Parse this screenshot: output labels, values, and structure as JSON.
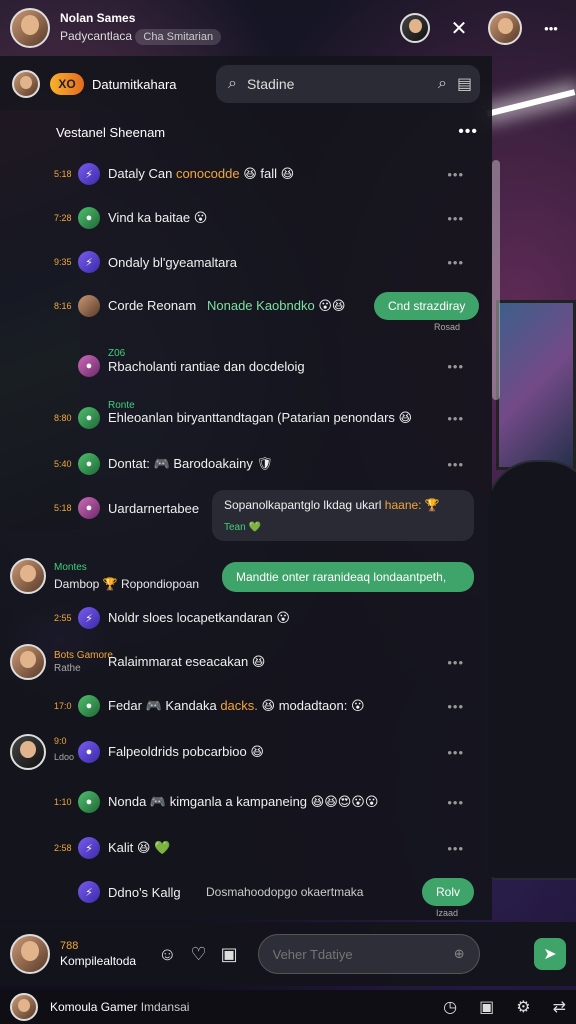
{
  "topbar": {
    "name": "Nolan Sames",
    "subtitle": "Padycantlaca",
    "pill": "Cha Smitarian",
    "close": "✕",
    "more": "•••"
  },
  "panel": {
    "brand_badge": "XO",
    "brand_name": "Datumitkahara",
    "search_value": "Stadine",
    "room_title": "Vestanel Sheenam",
    "more": "•••"
  },
  "messages": [
    {
      "time": "5:18",
      "text": "Dataly Can",
      "accent": "conocodde",
      "tail": "😆 fall 😆",
      "av": "v"
    },
    {
      "time": "7:28",
      "text": "Vind ka baitae 😮",
      "av": "g"
    },
    {
      "time": "9:35",
      "text": "Ondaly bl'gyeamaltara",
      "av": "v"
    },
    {
      "time": "8:16",
      "text": "Corde Reonam",
      "green": "Nonade Kaobndko",
      "tail": "😮😆",
      "bubble": "Cnd strazdiray",
      "meta": "Rosad",
      "av": "f"
    },
    {
      "tag": "Z06",
      "text": "Rbacholanti rantiae dan docdeloig",
      "av": "p"
    },
    {
      "tag": "Ronte",
      "text": "Ehleoanlan biryanttandtagan (Patarian penondars 😆",
      "av": "g",
      "time": "8:80"
    },
    {
      "time": "5:40",
      "text": "Dontat: 🎮 Barodoakainy 🛡",
      "av": "g"
    },
    {
      "time": "5:18",
      "text": "Uardarnertabee",
      "card": "Sopanolkapantglo lkdag ukarl",
      "card_acc": "haane:",
      "card_sub": "Tean",
      "av": "p"
    },
    {
      "tag": "Montes",
      "text": "Dambop 🏆 Ropondiopoan",
      "bubble": "Mandtie onter raranideaq londaantpeth,"
    },
    {
      "time": "2:55",
      "text": "Noldr sloes locapetkandaran 😮",
      "av": "v"
    },
    {
      "tag": "Bots Gamore",
      "sub": "Rathe",
      "text": "Ralaimmarat eseacakan 😆"
    },
    {
      "time": "17:0",
      "text": "Fedar 🎮 Kandaka",
      "accent": "dacks.",
      "tail": "😆 modadtaon: 😮",
      "av": "g"
    },
    {
      "time": "9:0",
      "sub": "Ldoo",
      "text": "Falpeoldrids pobcarbioo 😆"
    },
    {
      "time": "1:10",
      "text": "Nonda 🎮 kimganla a kampaneing 😆😆😍😮😮",
      "av": "g"
    },
    {
      "time": "2:58",
      "text": "Kalit 😆 💚",
      "av": "v"
    },
    {
      "text": "Ddno's Kallg",
      "tail_text": "Dosmahoodopgo okaertmaka",
      "bubble": "Rolv",
      "meta": "Izaad",
      "av": "v"
    }
  ],
  "compose": {
    "count": "788",
    "name": "Kompilealtoda",
    "placeholder": "Veher Tdatiye"
  },
  "footer": {
    "name": "Komoula Gamer",
    "sub": "Imdansai"
  }
}
